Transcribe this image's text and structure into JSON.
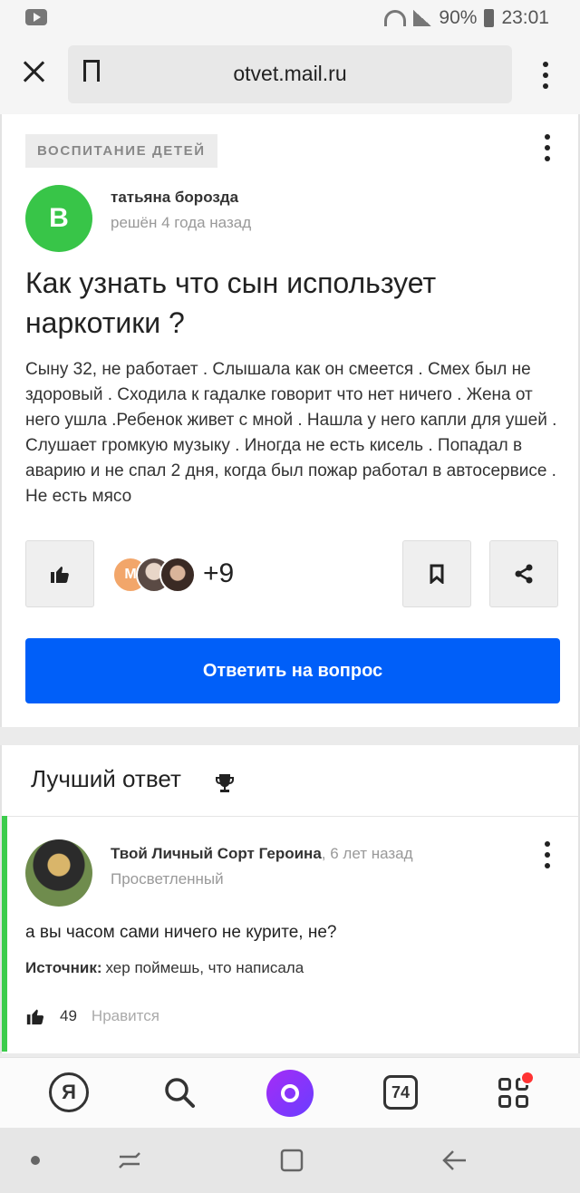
{
  "status_bar": {
    "battery": "90%",
    "time": "23:01",
    "icons": [
      "youtube-icon",
      "wifi-icon",
      "signal-icon",
      "battery-icon"
    ]
  },
  "browser": {
    "url": "otvet.mail.ru"
  },
  "question": {
    "category": "ВОСПИТАНИЕ ДЕТЕЙ",
    "avatar_letter": "В",
    "author": "татьяна борозда",
    "meta": "решён 4 года назад",
    "title": "Как узнать что сын использует наркотики ?",
    "body": "Сыну 32, не работает . Слышала как он смеется . Смех был не здоровый . Сходила к гадалке говорит что нет ничего . Жена от него ушла .Ребенок живет с мной . Нашла у него капли для ушей . Слушает громкую музыку . Иногда не есть кисель . Попадал в аварию и не спал 2 дня, когда был пожар работал в автосервисе . Не есть мясо",
    "like_count": "+9",
    "avatar_m": "М",
    "answer_button": "Ответить на вопрос"
  },
  "best_answer": {
    "header": "Лучший ответ",
    "author": "Твой Личный Сорт Героина",
    "time": ", 6 лет назад",
    "rank": "Просветленный",
    "text": "а вы часом сами ничего не курите, не?",
    "source_label": "Источник:",
    "source_text": "хер поймешь, что написала",
    "likes": "49",
    "like_label": "Нравится"
  },
  "bottom_nav": {
    "ya": "Я",
    "tabs_count": "74"
  },
  "colors": {
    "accent": "#005ff9",
    "green": "#38c548",
    "best_border": "#3ccc4c",
    "alice": "#8a35f8"
  }
}
